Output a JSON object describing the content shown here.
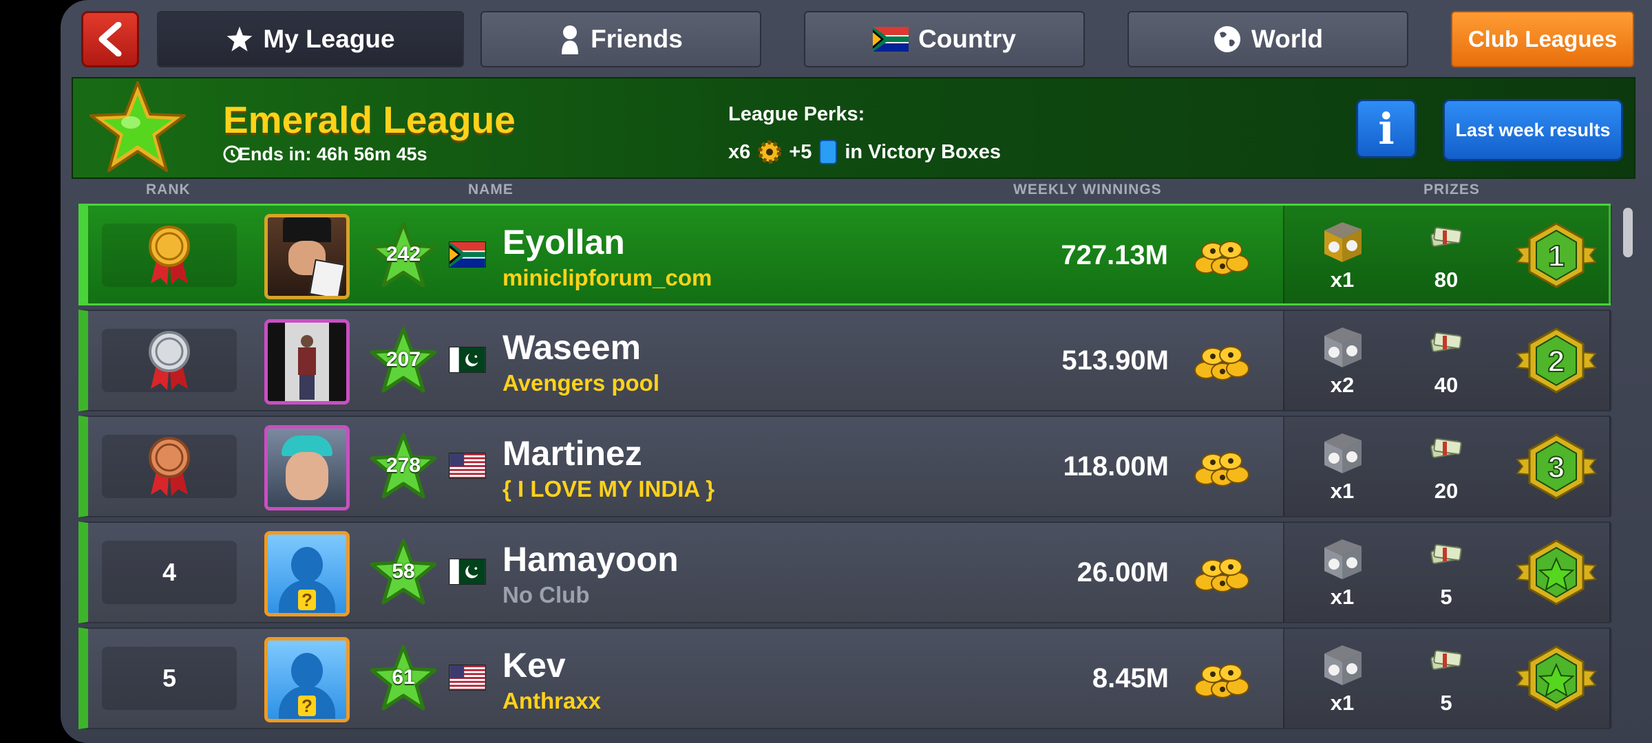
{
  "tabs": [
    {
      "label": "My League",
      "icon": "star-icon"
    },
    {
      "label": "Friends",
      "icon": "person-icon"
    },
    {
      "label": "Country",
      "icon": "south-africa-flag-icon"
    },
    {
      "label": "World",
      "icon": "globe-icon"
    },
    {
      "label": "Club Leagues"
    }
  ],
  "league": {
    "title": "Emerald League",
    "ends": "Ends in: 46h 56m 45s",
    "perks_label": "League Perks:",
    "perk_coin_mult": "x6",
    "perk_card_plus": "+5",
    "perk_suffix": "in Victory Boxes",
    "info_label": "i",
    "last_week": "Last week results"
  },
  "columns": {
    "rank": "RANK",
    "name": "NAME",
    "winnings": "WEEKLY WINNINGS",
    "prizes": "PRIZES"
  },
  "players": [
    {
      "rank": "1",
      "level": "242",
      "flag": "south-africa",
      "name": "Eyollan",
      "club": "miniclipforum_com",
      "winnings": "727.13M",
      "box": "x1",
      "box_color": "gold",
      "cash": "80",
      "badge": "1"
    },
    {
      "rank": "2",
      "level": "207",
      "flag": "pakistan",
      "name": "Waseem",
      "club": "Avengers pool",
      "winnings": "513.90M",
      "box": "x2",
      "box_color": "silver",
      "cash": "40",
      "badge": "2"
    },
    {
      "rank": "3",
      "level": "278",
      "flag": "usa",
      "name": "Martinez",
      "club": "{ I LOVE MY INDIA }",
      "winnings": "118.00M",
      "box": "x1",
      "box_color": "silver",
      "cash": "20",
      "badge": "3"
    },
    {
      "rank": "4",
      "level": "58",
      "flag": "pakistan",
      "name": "Hamayoon",
      "club": "No Club",
      "winnings": "26.00M",
      "box": "x1",
      "box_color": "silver",
      "cash": "5",
      "badge": ""
    },
    {
      "rank": "5",
      "level": "61",
      "flag": "usa",
      "name": "Kev",
      "club": "Anthraxx",
      "winnings": "8.45M",
      "box": "x1",
      "box_color": "silver",
      "cash": "5",
      "badge": ""
    }
  ],
  "colors": {
    "accent_green": "#3db52a",
    "gold_text": "#ffd21a",
    "club_orange": "#f28a1c",
    "info_blue": "#1f74e0"
  }
}
